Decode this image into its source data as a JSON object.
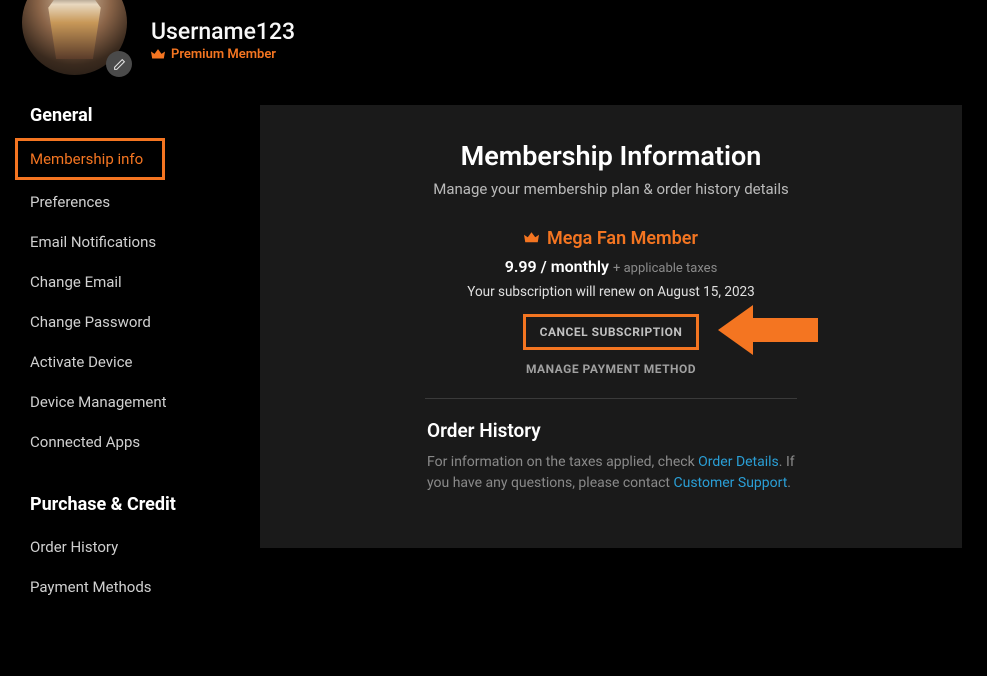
{
  "header": {
    "username": "Username123",
    "premium_label": "Premium Member"
  },
  "sidebar": {
    "sections": [
      {
        "title": "General",
        "items": [
          "Membership info",
          "Preferences",
          "Email Notifications",
          "Change Email",
          "Change Password",
          "Activate Device",
          "Device Management",
          "Connected Apps"
        ]
      },
      {
        "title": "Purchase & Credit",
        "items": [
          "Order History",
          "Payment Methods"
        ]
      }
    ]
  },
  "content": {
    "title": "Membership Information",
    "subtitle": "Manage your membership plan & order history details",
    "plan_name": "Mega Fan Member",
    "price": "9.99 / monthly",
    "tax_note": "+ applicable taxes",
    "renewal": "Your subscription will renew on August 15, 2023",
    "cancel_label": "CANCEL SUBSCRIPTION",
    "manage_payment_label": "MANAGE PAYMENT METHOD",
    "order_history": {
      "title": "Order History",
      "text_before": "For information on the taxes applied, check ",
      "link1": "Order Details",
      "text_mid": ". If you have any questions, please contact ",
      "link2": "Customer Support",
      "text_after": "."
    }
  }
}
